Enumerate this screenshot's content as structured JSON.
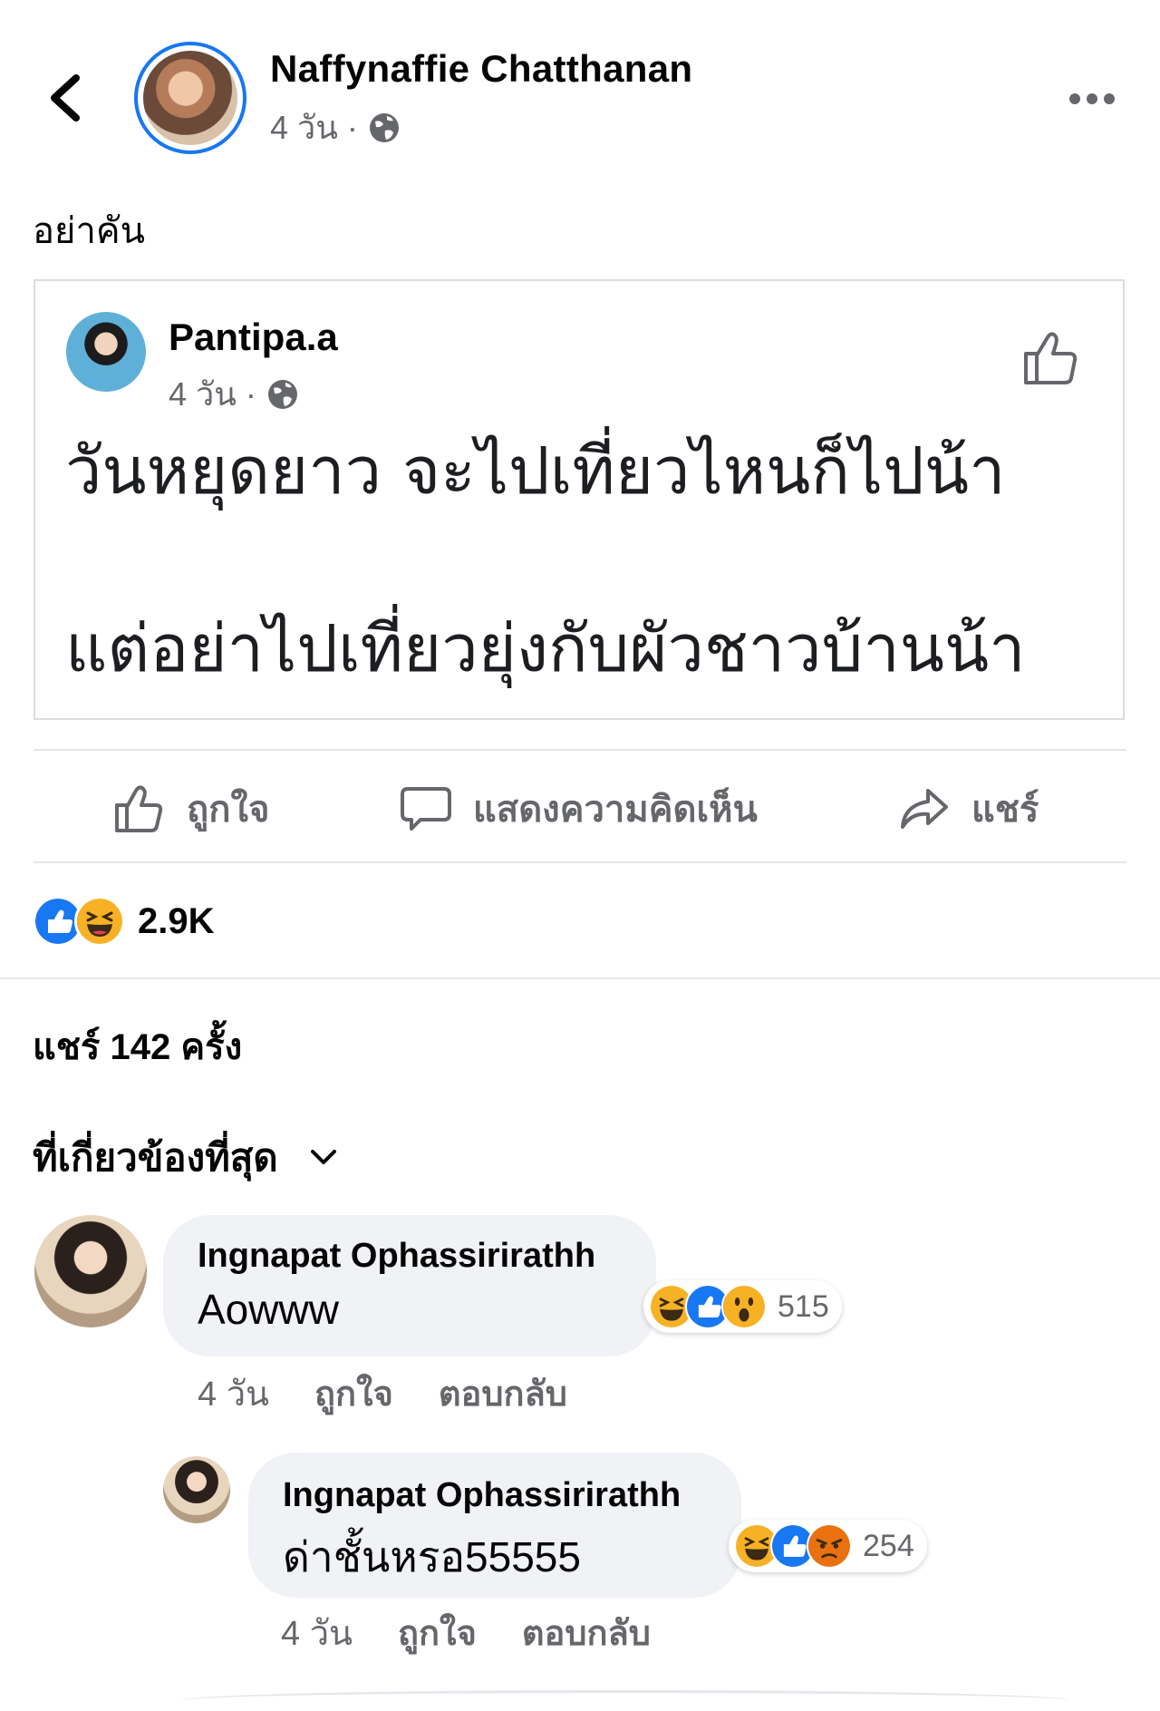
{
  "post": {
    "author": "Naffynaffie Chatthanan",
    "time": "4 วัน",
    "separator": "·",
    "caption": "อย่าคัน"
  },
  "shared": {
    "author": "Pantipa.a",
    "time": "4 วัน",
    "separator": "·",
    "lines": [
      "วันหยุดยาว จะไปเที่ยวไหนก็ไปน้า",
      "แต่อย่าไปเที่ยวยุ่งกับผัวชาวบ้านน้า"
    ]
  },
  "actions": {
    "like": "ถูกใจ",
    "comment": "แสดงความคิดเห็น",
    "share": "แชร์"
  },
  "reactions": {
    "count": "2.9K",
    "icons": [
      "like-icon",
      "haha-icon"
    ]
  },
  "shares": "แชร์ 142 ครั้ง",
  "sort": {
    "label": "ที่เกี่ยวข้องที่สุด"
  },
  "comments": [
    {
      "author": "Ingnapat Ophassirirathh",
      "text": "Aowww",
      "time": "4 วัน",
      "like": "ถูกใจ",
      "reply": "ตอบกลับ",
      "reaction_count": "515",
      "reaction_icons": [
        "haha-icon",
        "like-icon",
        "wow-icon"
      ]
    },
    {
      "author": "Ingnapat Ophassirirathh",
      "text": "ด่าชั้นหรอ55555",
      "time": "4 วัน",
      "like": "ถูกใจ",
      "reply": "ตอบกลับ",
      "reaction_count": "254",
      "reaction_icons": [
        "haha-icon",
        "like-icon",
        "angry-icon"
      ]
    }
  ],
  "colors": {
    "accent": "#1877f2",
    "muted": "#65676b",
    "bubble": "#f0f2f5",
    "haha": "#f7b125",
    "angry": "#e9710f"
  }
}
